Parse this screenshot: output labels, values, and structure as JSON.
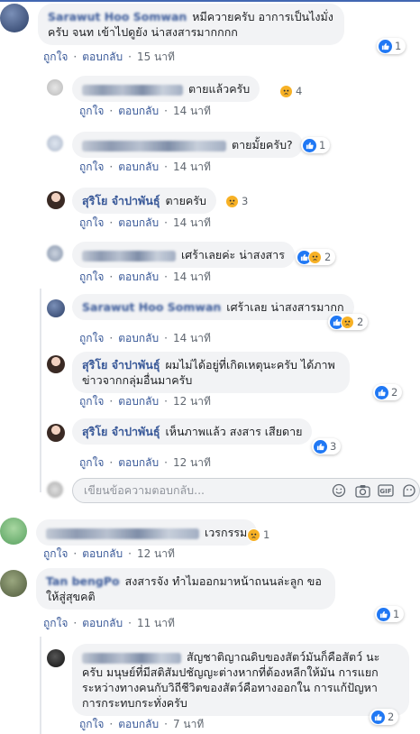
{
  "labels": {
    "like": "ถูกใจ",
    "reply": "ตอบกลับ",
    "dot": "·"
  },
  "colors": {
    "link": "#385898",
    "like_blue": "#2078f4",
    "sad_yellow": "#f7b125",
    "bubble": "#f2f3f5"
  },
  "comments": [
    {
      "name": "Sarawut Hoo Somwan",
      "text": "หมีควายครับ อาการเป็นไงมั่งครับ จนท เข้าไปดูยัง น่าสงสารมากกกก",
      "time": "15 นาที",
      "reactions": {
        "count": "1",
        "icons": [
          "like-icon"
        ]
      }
    },
    {
      "name": "Sattawat Baed",
      "text": "ตายแล้วครับ",
      "time": "14 นาที",
      "reactions": {
        "count": "4",
        "icons": [
          "sad-icon"
        ]
      }
    },
    {
      "name": "",
      "text": "ตายมั้ยครับ?",
      "time": "14 นาที",
      "reactions": {
        "count": "1",
        "icons": [
          "like-icon"
        ]
      }
    },
    {
      "name": "สุริโย จำปาพันธุ์",
      "text": "ตายครับ",
      "time": "14 นาที",
      "reactions": {
        "count": "3",
        "icons": [
          "sad-icon"
        ]
      }
    },
    {
      "name": "",
      "text": "เศร้าเลยค่ะ น่าสงสาร",
      "time": "14 นาที",
      "reactions": {
        "count": "2",
        "icons": [
          "like-icon",
          "sad-icon"
        ]
      }
    },
    {
      "name": "Sarawut Hoo Somwan",
      "text": "เศร้าเลย น่าสงสารมากก",
      "time": "14 นาที",
      "reactions": {
        "count": "2",
        "icons": [
          "like-icon",
          "sad-icon"
        ]
      }
    },
    {
      "name": "สุริโย จำปาพันธุ์",
      "text": "ผมไม่ได้อยู่ที่เกิดเหตุนะครับ ได้ภาพข่าวจากกลุ่มอื่นมาครับ",
      "time": "12 นาที",
      "reactions": {
        "count": "2",
        "icons": [
          "like-icon"
        ]
      }
    },
    {
      "name": "สุริโย จำปาพันธุ์",
      "text": "เห็นภาพแล้ว สงสาร เสียดาย",
      "time": "12 นาที",
      "reactions": {
        "count": "3",
        "icons": [
          "like-icon"
        ]
      }
    },
    {
      "name": "",
      "text": "เวรกรรม",
      "time": "12 นาที",
      "reactions": {
        "count": "1",
        "icons": [
          "sad-icon"
        ]
      }
    },
    {
      "name": "Tan bengPo",
      "text": "สงสารจัง ทำไมออกมาหน้าถนนล่ะลูก ขอให้สู่สุขคติ",
      "time": "11 นาที",
      "reactions": {
        "count": "1",
        "icons": [
          "like-icon"
        ]
      }
    },
    {
      "name": "",
      "text": "สัญชาติญาณดิบของสัตว์มันก็คือสัตว์ นะครับ มนุษย์ที่มีสติสัมปชัญญะต่างหากที่ต้องหลีกให้มัน การแยกระหว่างทางคนกับวิถีชีวิตของสัตว์คือทางออกใน การแก้ปัญหาการกระทบกระทั่งครับ",
      "time": "7 นาที",
      "reactions": {
        "count": "2",
        "icons": [
          "like-icon"
        ]
      }
    }
  ],
  "reply_box": {
    "placeholder": "เขียนข้อความตอบกลับ...",
    "icons": [
      "emoji-icon",
      "camera-icon",
      "gif-icon",
      "sticker-icon"
    ]
  }
}
